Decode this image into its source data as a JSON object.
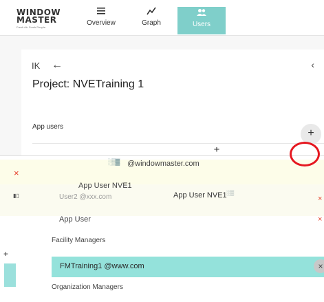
{
  "logo": {
    "line1": "WINDOW",
    "line2": "MASTER",
    "tagline": "Fresh Air. Fresh People."
  },
  "nav": {
    "tabs": [
      {
        "label": "Overview",
        "icon": "menu-icon"
      },
      {
        "label": "Graph",
        "icon": "line-chart-icon"
      },
      {
        "label": "Users",
        "icon": "users-icon",
        "active": true
      }
    ]
  },
  "project": {
    "title": "Project: NVETraining 1",
    "section_label": "App users",
    "add_symbol": "+",
    "first_symbol": "K",
    "back_symbol": "←",
    "collapse_symbol": "‹"
  },
  "overlay": {
    "email_tail": "@windowmaster.com",
    "x_symbol": "×",
    "app_user_left": "App User NVE1",
    "app_user_right": "App User NVE1",
    "user2_email": "User2 @xxx.com",
    "row_label": "App User",
    "facility_managers_label": "Facility Managers",
    "fm_user": "FMTraining1 @www.com",
    "organization_managers_label": "Organization Managers"
  },
  "colors": {
    "accent": "#7fcfca",
    "highlight_row": "#94e2db",
    "remove": "#e5402a",
    "annotation_ring": "#e5171f"
  }
}
